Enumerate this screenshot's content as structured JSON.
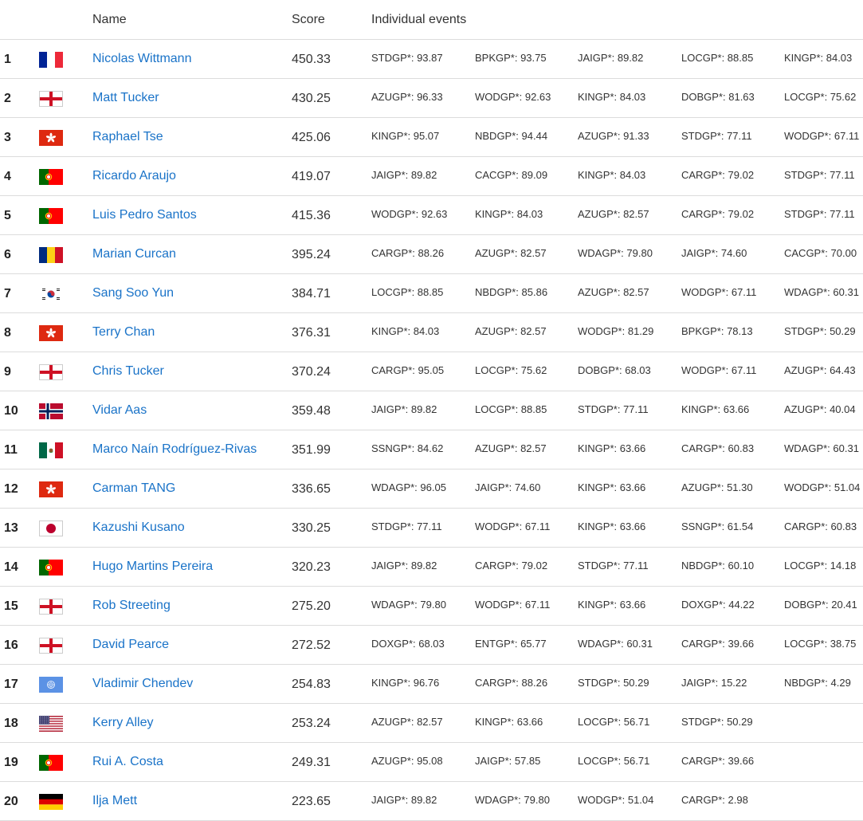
{
  "header": {
    "name": "Name",
    "score": "Score",
    "events": "Individual events"
  },
  "rows": [
    {
      "rank": "1",
      "flag": "fr",
      "name": "Nicolas Wittmann",
      "score": "450.33",
      "events": [
        "STDGP*: 93.87",
        "BPKGP*: 93.75",
        "JAIGP*: 89.82",
        "LOCGP*: 88.85",
        "KINGP*: 84.03"
      ]
    },
    {
      "rank": "2",
      "flag": "en",
      "name": "Matt Tucker",
      "score": "430.25",
      "events": [
        "AZUGP*: 96.33",
        "WODGP*: 92.63",
        "KINGP*: 84.03",
        "DOBGP*: 81.63",
        "LOCGP*: 75.62"
      ]
    },
    {
      "rank": "3",
      "flag": "hk",
      "name": "Raphael Tse",
      "score": "425.06",
      "events": [
        "KINGP*: 95.07",
        "NBDGP*: 94.44",
        "AZUGP*: 91.33",
        "STDGP*: 77.11",
        "WODGP*: 67.11"
      ]
    },
    {
      "rank": "4",
      "flag": "pt",
      "name": "Ricardo Araujo",
      "score": "419.07",
      "events": [
        "JAIGP*: 89.82",
        "CACGP*: 89.09",
        "KINGP*: 84.03",
        "CARGP*: 79.02",
        "STDGP*: 77.11"
      ]
    },
    {
      "rank": "5",
      "flag": "pt",
      "name": "Luis Pedro Santos",
      "score": "415.36",
      "events": [
        "WODGP*: 92.63",
        "KINGP*: 84.03",
        "AZUGP*: 82.57",
        "CARGP*: 79.02",
        "STDGP*: 77.11"
      ]
    },
    {
      "rank": "6",
      "flag": "ro",
      "name": "Marian Curcan",
      "score": "395.24",
      "events": [
        "CARGP*: 88.26",
        "AZUGP*: 82.57",
        "WDAGP*: 79.80",
        "JAIGP*: 74.60",
        "CACGP*: 70.00"
      ]
    },
    {
      "rank": "7",
      "flag": "kr",
      "name": "Sang Soo Yun",
      "score": "384.71",
      "events": [
        "LOCGP*: 88.85",
        "NBDGP*: 85.86",
        "AZUGP*: 82.57",
        "WODGP*: 67.11",
        "WDAGP*: 60.31"
      ]
    },
    {
      "rank": "8",
      "flag": "hk",
      "name": "Terry Chan",
      "score": "376.31",
      "events": [
        "KINGP*: 84.03",
        "AZUGP*: 82.57",
        "WODGP*: 81.29",
        "BPKGP*: 78.13",
        "STDGP*: 50.29"
      ]
    },
    {
      "rank": "9",
      "flag": "en",
      "name": "Chris Tucker",
      "score": "370.24",
      "events": [
        "CARGP*: 95.05",
        "LOCGP*: 75.62",
        "DOBGP*: 68.03",
        "WODGP*: 67.11",
        "AZUGP*: 64.43"
      ]
    },
    {
      "rank": "10",
      "flag": "no",
      "name": "Vidar Aas",
      "score": "359.48",
      "events": [
        "JAIGP*: 89.82",
        "LOCGP*: 88.85",
        "STDGP*: 77.11",
        "KINGP*: 63.66",
        "AZUGP*: 40.04"
      ]
    },
    {
      "rank": "11",
      "flag": "mx",
      "name": "Marco Naín Rodríguez-Rivas",
      "score": "351.99",
      "events": [
        "SSNGP*: 84.62",
        "AZUGP*: 82.57",
        "KINGP*: 63.66",
        "CARGP*: 60.83",
        "WDAGP*: 60.31"
      ]
    },
    {
      "rank": "12",
      "flag": "hk",
      "name": "Carman TANG",
      "score": "336.65",
      "events": [
        "WDAGP*: 96.05",
        "JAIGP*: 74.60",
        "KINGP*: 63.66",
        "AZUGP*: 51.30",
        "WODGP*: 51.04"
      ]
    },
    {
      "rank": "13",
      "flag": "jp",
      "name": "Kazushi Kusano",
      "score": "330.25",
      "events": [
        "STDGP*: 77.11",
        "WODGP*: 67.11",
        "KINGP*: 63.66",
        "SSNGP*: 61.54",
        "CARGP*: 60.83"
      ]
    },
    {
      "rank": "14",
      "flag": "pt",
      "name": "Hugo Martins Pereira",
      "score": "320.23",
      "events": [
        "JAIGP*: 89.82",
        "CARGP*: 79.02",
        "STDGP*: 77.11",
        "NBDGP*: 60.10",
        "LOCGP*: 14.18"
      ]
    },
    {
      "rank": "15",
      "flag": "en",
      "name": "Rob Streeting",
      "score": "275.20",
      "events": [
        "WDAGP*: 79.80",
        "WODGP*: 67.11",
        "KINGP*: 63.66",
        "DOXGP*: 44.22",
        "DOBGP*: 20.41"
      ]
    },
    {
      "rank": "16",
      "flag": "en",
      "name": "David Pearce",
      "score": "272.52",
      "events": [
        "DOXGP*: 68.03",
        "ENTGP*: 65.77",
        "WDAGP*: 60.31",
        "CARGP*: 39.66",
        "LOCGP*: 38.75"
      ]
    },
    {
      "rank": "17",
      "flag": "un",
      "name": "Vladimir Chendev",
      "score": "254.83",
      "events": [
        "KINGP*: 96.76",
        "CARGP*: 88.26",
        "STDGP*: 50.29",
        "JAIGP*: 15.22",
        "NBDGP*: 4.29"
      ]
    },
    {
      "rank": "18",
      "flag": "us",
      "name": "Kerry Alley",
      "score": "253.24",
      "events": [
        "AZUGP*: 82.57",
        "KINGP*: 63.66",
        "LOCGP*: 56.71",
        "STDGP*: 50.29"
      ]
    },
    {
      "rank": "19",
      "flag": "pt",
      "name": "Rui A. Costa",
      "score": "249.31",
      "events": [
        "AZUGP*: 95.08",
        "JAIGP*: 57.85",
        "LOCGP*: 56.71",
        "CARGP*: 39.66"
      ]
    },
    {
      "rank": "20",
      "flag": "de",
      "name": "Ilja Mett",
      "score": "223.65",
      "events": [
        "JAIGP*: 89.82",
        "WDAGP*: 79.80",
        "WODGP*: 51.04",
        "CARGP*: 2.98"
      ]
    }
  ]
}
